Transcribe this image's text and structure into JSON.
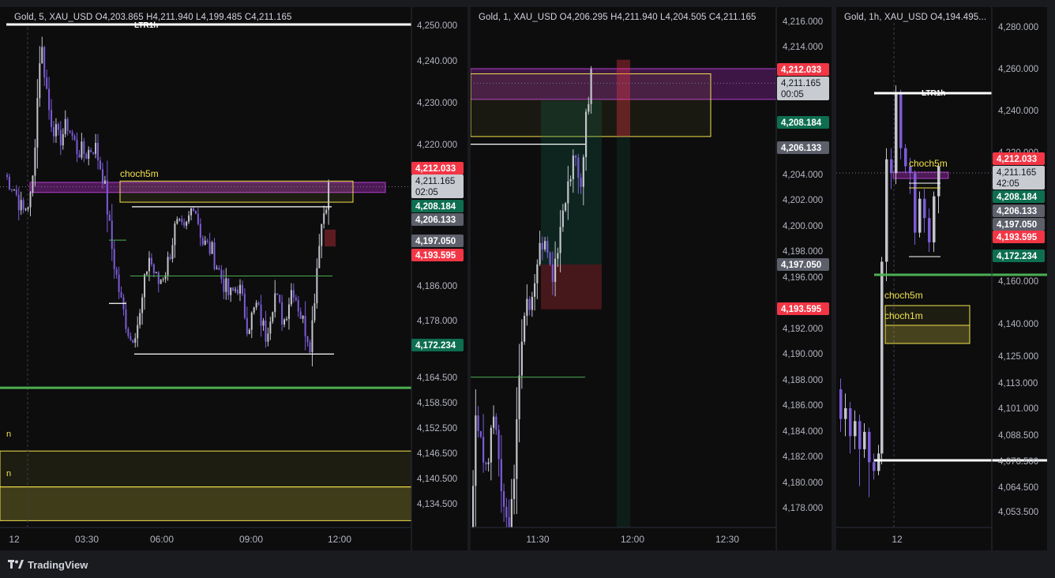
{
  "panels": [
    {
      "id": "a",
      "legend": "Gold, 5, XAU_USD  O4,203.865  H4,211.940  L4,199.485  C4,211.165",
      "price_axis": [
        "4,250.000",
        "4,240.000",
        "4,230.000",
        "4,220.000",
        "4,212.033",
        "4,211.165",
        "4,208.184",
        "4,206.133",
        "4,197.050",
        "4,193.595",
        "4,186.000",
        "4,178.000",
        "4,172.234",
        "4,164.500",
        "4,158.500",
        "4,152.500",
        "4,146.500",
        "4,140.500",
        "4,134.500"
      ],
      "time_axis": [
        "12",
        "03:30",
        "06:00",
        "09:00",
        "12:00"
      ],
      "badges": {
        "high": "4,212.033",
        "current": "4,211.165",
        "countdown": "02:05",
        "green": "4,208.184",
        "gray": "4,206.133",
        "gray2": "4,197.050",
        "red": "4,193.595",
        "low_green": "4,172.234"
      },
      "labels": {
        "choch": "choch5m",
        "ltr": "LTR1h",
        "partial_1": "n",
        "partial_2": "n"
      }
    },
    {
      "id": "b",
      "legend": "Gold, 1, XAU_USD  O4,206.295  H4,211.940  L4,204.505  C4,211.165",
      "price_axis": [
        "4,216.000",
        "4,214.000",
        "4,212.033",
        "4,211.165",
        "4,208.184",
        "4,206.133",
        "4,204.000",
        "4,202.000",
        "4,200.000",
        "4,198.000",
        "4,197.050",
        "4,196.000",
        "4,194.000",
        "4,193.595",
        "4,192.000",
        "4,190.000",
        "4,188.000",
        "4,186.000",
        "4,184.000",
        "4,182.000",
        "4,180.000",
        "4,178.000"
      ],
      "time_axis": [
        "11:30",
        "12:00",
        "12:30"
      ],
      "badges": {
        "high": "4,212.033",
        "current": "4,211.165",
        "countdown": "00:05",
        "green": "4,208.184",
        "gray": "4,206.133",
        "gray2": "4,197.050",
        "red": "4,193.595"
      }
    },
    {
      "id": "c",
      "legend": "Gold, 1h, XAU_USD  O4,194.495...",
      "price_axis": [
        "4,280.000",
        "4,260.000",
        "4,240.000",
        "4,220.000",
        "4,204.000",
        "4,160.000",
        "4,140.000",
        "4,125.000",
        "4,113.000",
        "4,101.000",
        "4,088.500",
        "4,076.500",
        "4,064.500",
        "4,053.500"
      ],
      "time_axis": [
        "12"
      ],
      "badges": {
        "high": "4,212.033",
        "current": "4,211.165",
        "countdown": "42:05",
        "green": "4,208.184",
        "gray": "4,206.133",
        "gray2": "4,197.050",
        "red": "4,193.595",
        "low_green": "4,172.234"
      },
      "labels": {
        "ltr": "LTR1h",
        "choch5": "choch5m",
        "choch1": "choch1m"
      }
    }
  ],
  "footer": {
    "brand": "TradingView"
  },
  "colors": {
    "background": "#0d0d0e",
    "candle_up": "#c3c5cb",
    "candle_down": "#7b5cd6",
    "zone_yellow": "#f2e24a",
    "zone_purple": "#9c27b0",
    "green_line": "#4caf50",
    "badge_red": "#f23645",
    "badge_green": "#0e6e50",
    "badge_gray": "#5d606b"
  }
}
